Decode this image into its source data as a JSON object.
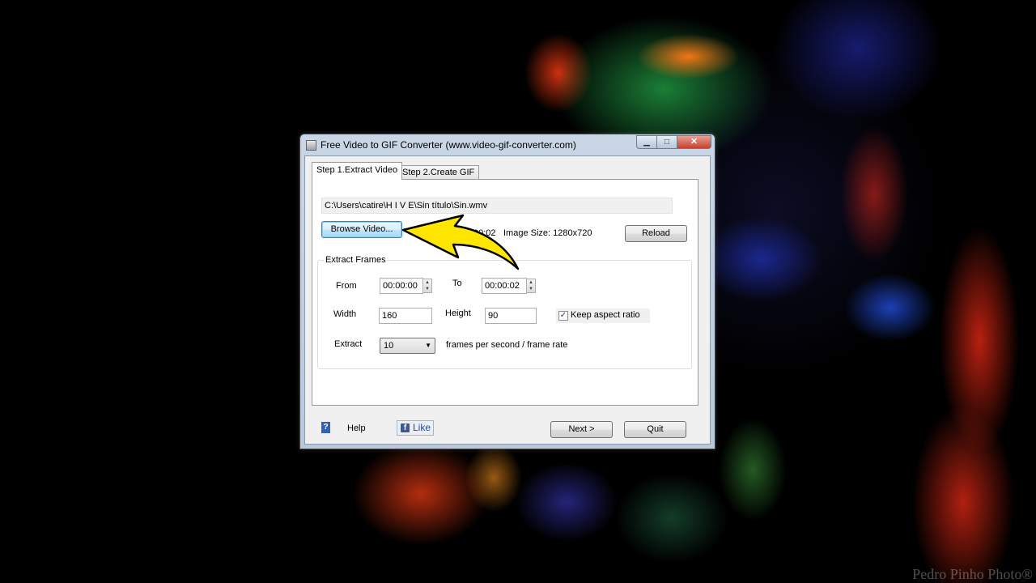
{
  "window": {
    "title": "Free Video to GIF Converter (www.video-gif-converter.com)",
    "minimize_glyph": "▁",
    "maximize_glyph": "□",
    "close_glyph": "✕"
  },
  "tabs": [
    {
      "label": "Step 1.Extract Video",
      "active": true
    },
    {
      "label": "Step 2.Create GIF",
      "active": false
    }
  ],
  "video": {
    "path": "C:\\Users\\catire\\H I V E\\Sin título\\Sin.wmv",
    "browse_label": "Browse Video...",
    "duration_partial": "00:02",
    "image_size": "Image Size: 1280x720",
    "reload_label": "Reload"
  },
  "extract_frames": {
    "group_title": "Extract Frames",
    "from_label": "From",
    "from_value": "00:00:00",
    "to_label": "To",
    "to_value": "00:00:02",
    "width_label": "Width",
    "width_value": "160",
    "height_label": "Height",
    "height_value": "90",
    "keep_aspect_label": "Keep aspect ratio",
    "keep_aspect_checked": true,
    "extract_label": "Extract",
    "extract_value": "10",
    "frame_rate_label": "frames per second / frame rate"
  },
  "footer": {
    "help_icon": "?",
    "help_label": "Help",
    "like_label": "Like",
    "fb_glyph": "f",
    "next_label": "Next >",
    "quit_label": "Quit"
  },
  "watermark": "Pedro Pinho Photo®",
  "colors": {
    "annotation_arrow": "#ffe600",
    "focus_button_border": "#3c7fb1",
    "close_button": "#c7402a"
  },
  "icons": {
    "app": "video-gif-app-icon",
    "help": "help-icon",
    "facebook": "facebook-icon",
    "annotation": "yellow-arrow-icon"
  }
}
